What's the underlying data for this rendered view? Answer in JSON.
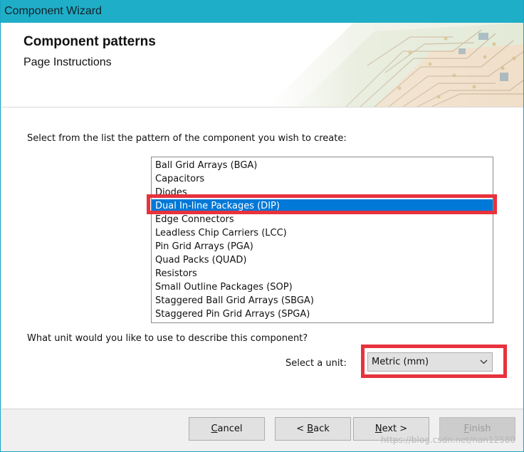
{
  "window": {
    "title": "Component Wizard"
  },
  "header": {
    "title": "Component patterns",
    "subtitle": "Page Instructions"
  },
  "main": {
    "instruction": "Select from the list the pattern of the component you wish to create:",
    "patterns": [
      "Ball Grid Arrays (BGA)",
      "Capacitors",
      "Diodes",
      "Dual In-line Packages (DIP)",
      "Edge Connectors",
      "Leadless Chip Carriers (LCC)",
      "Pin Grid Arrays (PGA)",
      "Quad Packs (QUAD)",
      "Resistors",
      "Small Outline Packages (SOP)",
      "Staggered Ball Grid Arrays (SBGA)",
      "Staggered Pin Grid Arrays (SPGA)"
    ],
    "selected_pattern_index": 3,
    "unit_question": "What unit would you like to use to describe this component?",
    "unit_label": "Select a unit:",
    "unit_value": "Metric (mm)"
  },
  "footer": {
    "cancel": {
      "accel": "C",
      "rest": "ancel"
    },
    "back": {
      "pre": "< ",
      "accel": "B",
      "rest": "ack"
    },
    "next": {
      "accel": "N",
      "rest": "ext >"
    },
    "finish": {
      "accel": "F",
      "rest": "inish"
    },
    "watermark": "https://blog.csdn.net/nan12580"
  },
  "colors": {
    "titlebar": "#1faec7",
    "selection": "#0078d7",
    "highlight": "#e8323c"
  }
}
